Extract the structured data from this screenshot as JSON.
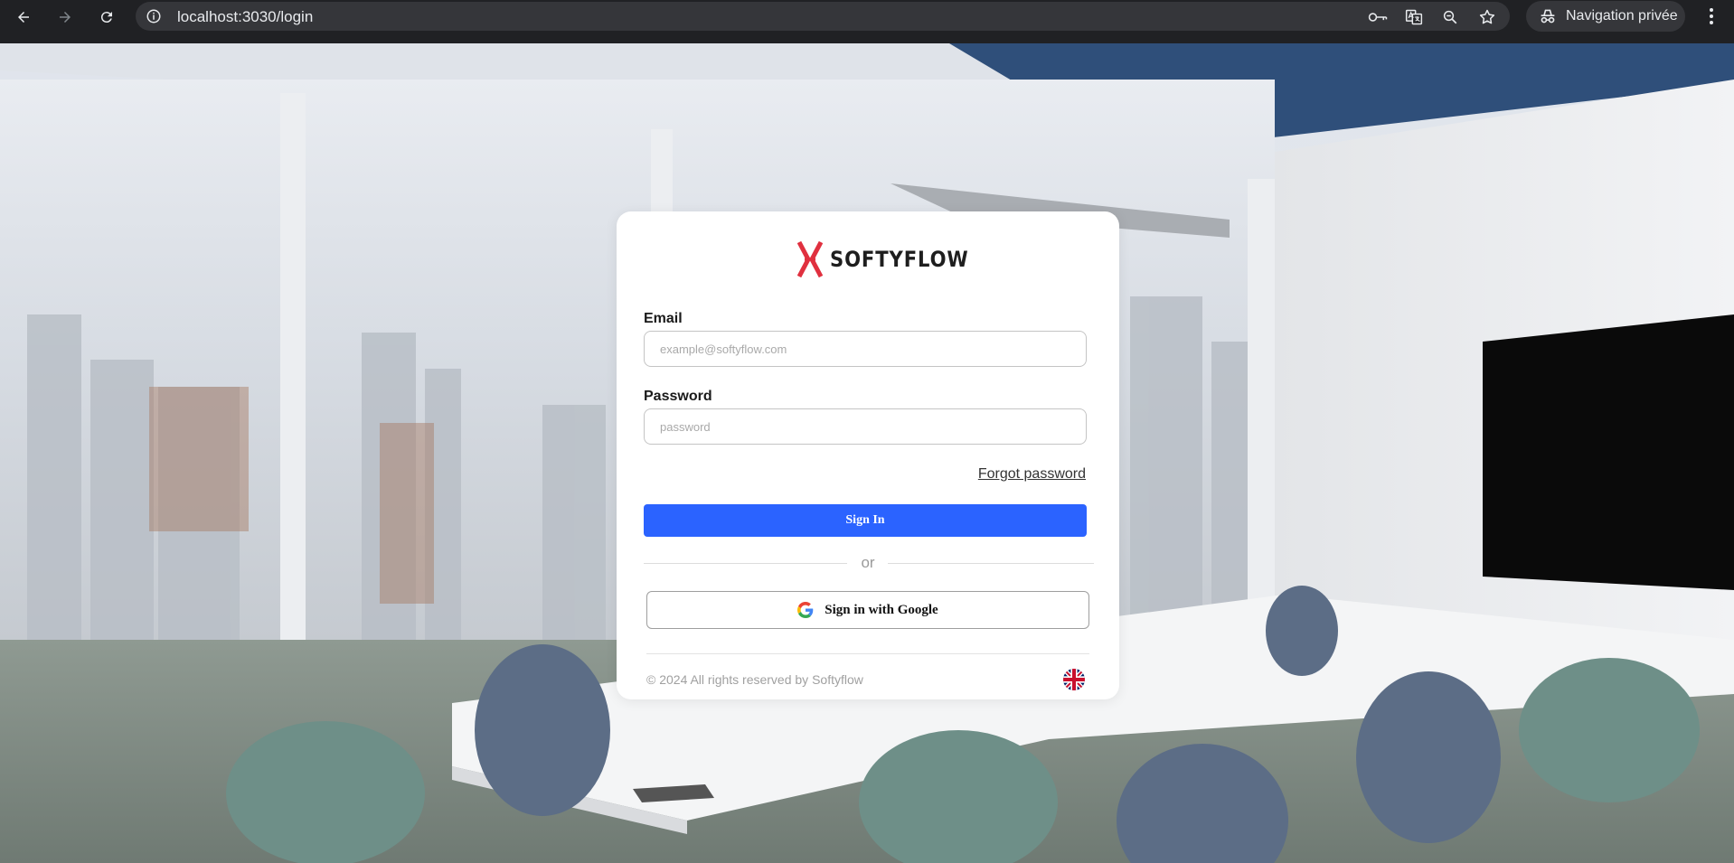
{
  "browser": {
    "url": "localhost:3030/login",
    "private_label": "Navigation privée"
  },
  "brand": {
    "name": "SOFTYFLOW",
    "logo_color": "#e0303f"
  },
  "form": {
    "email_label": "Email",
    "email_placeholder": "example@softyflow.com",
    "email_value": "",
    "password_label": "Password",
    "password_placeholder": "password",
    "password_value": "",
    "forgot_label": "Forgot password",
    "signin_label": "Sign In",
    "or_label": "or",
    "google_label": "Sign in with Google"
  },
  "footer": {
    "copyright": "© 2024 All rights reserved by Softyflow",
    "language_flag": "uk-flag-icon"
  },
  "colors": {
    "primary": "#2b63ff",
    "browser_bar": "#202124",
    "card": "#ffffff"
  }
}
